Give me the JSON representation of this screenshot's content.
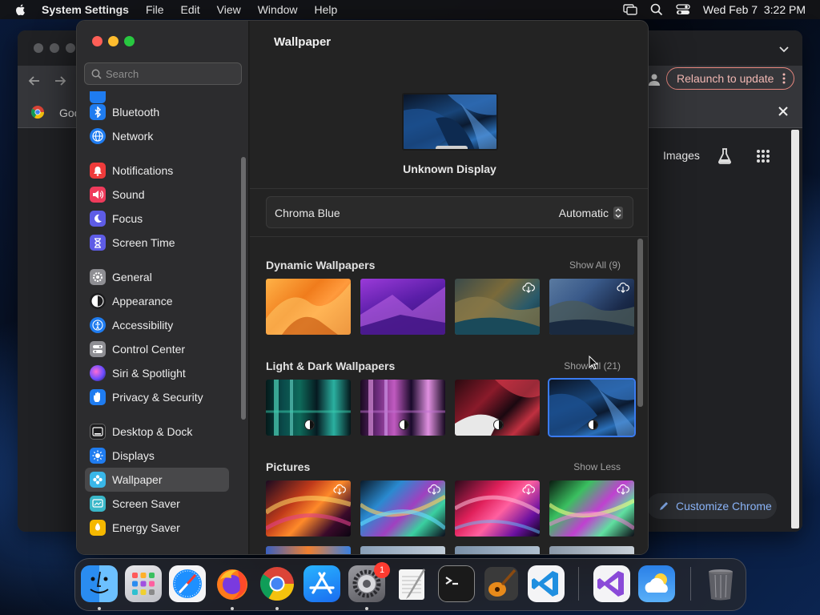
{
  "menubar": {
    "app_name": "System Settings",
    "items": [
      "File",
      "Edit",
      "View",
      "Window",
      "Help"
    ],
    "datetime": "Wed Feb 7  3:22 PM"
  },
  "chrome": {
    "relaunch_label": "Relaunch to update",
    "tab_partial_text": "Goo",
    "images_label": "Images",
    "customize_label": "Customize Chrome"
  },
  "settings": {
    "search_placeholder": "Search",
    "sidebar": [
      {
        "label": "Bluetooth",
        "icon": "bluetooth-icon",
        "color": "#1f7cf0"
      },
      {
        "label": "Network",
        "icon": "globe-icon",
        "color": "#1f7cf0"
      },
      {
        "label": "Notifications",
        "icon": "bell-icon",
        "color": "#ef3b3b"
      },
      {
        "label": "Sound",
        "icon": "speaker-icon",
        "color": "#ef3b5b"
      },
      {
        "label": "Focus",
        "icon": "moon-icon",
        "color": "#5e5ce6"
      },
      {
        "label": "Screen Time",
        "icon": "hourglass-icon",
        "color": "#5e5ce6"
      },
      {
        "label": "General",
        "icon": "gear-icon",
        "color": "#8e8e93"
      },
      {
        "label": "Appearance",
        "icon": "appearance-icon",
        "color": "#1c1c1e"
      },
      {
        "label": "Accessibility",
        "icon": "accessibility-icon",
        "color": "#1f7cf0"
      },
      {
        "label": "Control Center",
        "icon": "control-center-icon",
        "color": "#8e8e93"
      },
      {
        "label": "Siri & Spotlight",
        "icon": "siri-icon",
        "color": "#9b4de0"
      },
      {
        "label": "Privacy & Security",
        "icon": "hand-icon",
        "color": "#1f7cf0"
      },
      {
        "label": "Desktop & Dock",
        "icon": "dock-icon",
        "color": "#1c1c1e"
      },
      {
        "label": "Displays",
        "icon": "sun-icon",
        "color": "#1f7cf0"
      },
      {
        "label": "Wallpaper",
        "icon": "flower-icon",
        "color": "#39b7e8"
      },
      {
        "label": "Screen Saver",
        "icon": "screen-saver-icon",
        "color": "#39b7c8"
      },
      {
        "label": "Energy Saver",
        "icon": "battery-icon",
        "color": "#f5b800"
      }
    ],
    "selected_item": "Wallpaper",
    "main": {
      "title": "Wallpaper",
      "display_name": "Unknown Display",
      "current_wallpaper": "Chroma Blue",
      "appearance_mode": "Automatic",
      "sections": [
        {
          "title": "Dynamic Wallpapers",
          "action": "Show All (9)"
        },
        {
          "title": "Light & Dark Wallpapers",
          "action": "Show All (21)"
        },
        {
          "title": "Pictures",
          "action": "Show Less"
        }
      ]
    }
  },
  "dock": {
    "apps": [
      "Finder",
      "Launchpad",
      "Safari",
      "Firefox",
      "Google Chrome",
      "App Store",
      "System Settings",
      "TextEdit",
      "Terminal",
      "GarageBand",
      "Visual Studio Code",
      "Visual Studio",
      "Weather",
      "Trash"
    ],
    "system_settings_badge": "1"
  }
}
